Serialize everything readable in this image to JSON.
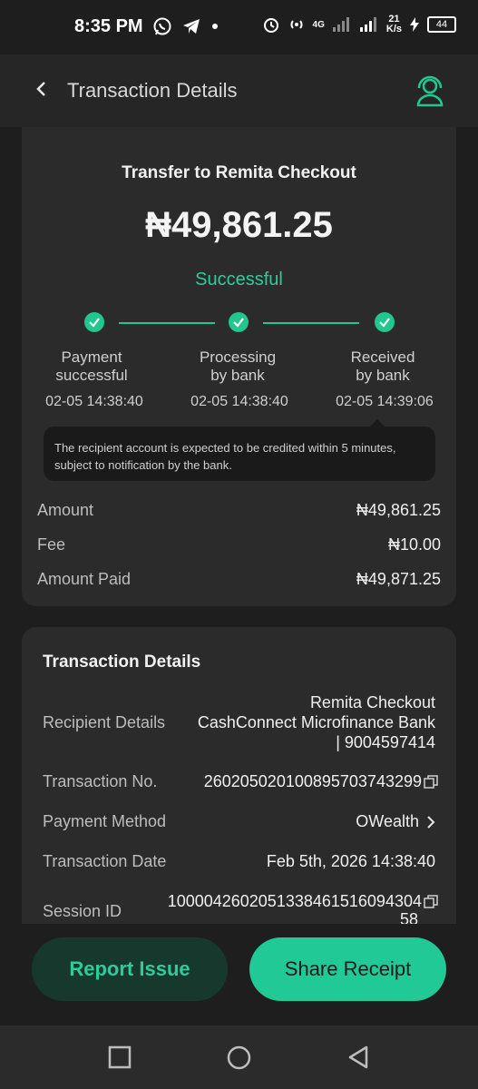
{
  "status_bar": {
    "time": "8:35 PM",
    "speed_top": "21",
    "speed_bottom": "K/s",
    "battery": "44",
    "network": "4G"
  },
  "header": {
    "title": "Transaction Details",
    "back_icon": "chevron-left-icon",
    "support_icon": "headset-support-icon"
  },
  "summary": {
    "title": "Transfer to Remita Checkout",
    "amount": "₦49,861.25",
    "status": "Successful",
    "status_color": "#2ecc9b",
    "steps": [
      {
        "label_line1": "Payment",
        "label_line2": "successful",
        "time": "02-05 14:38:40"
      },
      {
        "label_line1": "Processing",
        "label_line2": "by bank",
        "time": "02-05 14:38:40"
      },
      {
        "label_line1": "Received",
        "label_line2": "by bank",
        "time": "02-05 14:39:06"
      }
    ],
    "note": "The recipient account is expected to be credited within 5 minutes, subject to notification by the bank.",
    "amount_label": "Amount",
    "amount_value": "₦49,861.25",
    "fee_label": "Fee",
    "fee_value": "₦10.00",
    "paid_label": "Amount Paid",
    "paid_value": "₦49,871.25"
  },
  "details": {
    "title": "Transaction Details",
    "recipient_label": "Recipient Details",
    "recipient_line1": "Remita Checkout",
    "recipient_line2": "CashConnect Microfinance Bank",
    "recipient_line3": "| 9004597414",
    "txn_no_label": "Transaction No.",
    "txn_no_value": "260205020100895703743299",
    "method_label": "Payment Method",
    "method_value": "OWealth",
    "date_label": "Transaction Date",
    "date_value": "Feb 5th, 2026 14:38:40",
    "session_label": "Session ID",
    "session_line1": "100004260205133846151609430​4",
    "session_line2": "58"
  },
  "actions": {
    "report": "Report Issue",
    "share": "Share Receipt"
  },
  "colors": {
    "accent": "#21c78e",
    "background": "#1e1e1e",
    "card": "#2b2b2b"
  }
}
